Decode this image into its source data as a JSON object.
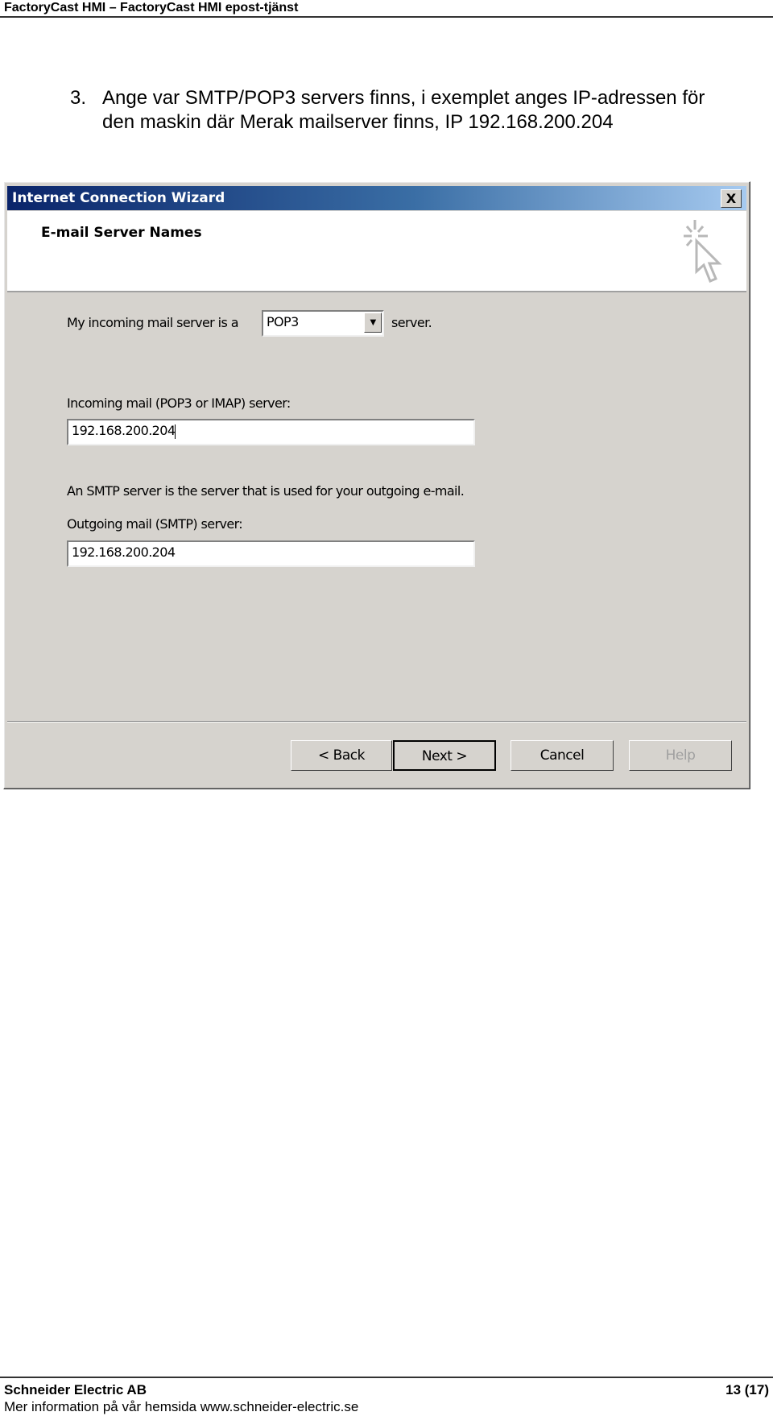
{
  "header": {
    "title": "FactoryCast HMI – FactoryCast HMI epost-tjänst"
  },
  "instruction": {
    "number": "3.",
    "line1": "Ange var SMTP/POP3 servers finns, i exemplet anges IP-adressen för",
    "line2": "den maskin där Merak mailserver finns, IP 192.168.200.204"
  },
  "dialog": {
    "title": "Internet Connection Wizard",
    "close_label": "X",
    "page_title": "E-mail Server Names",
    "icon": "wizard-cursor-icon",
    "server_type_prefix": "My incoming mail server is a",
    "server_type_value": "POP3",
    "server_type_suffix": "server.",
    "incoming_label": "Incoming mail (POP3 or IMAP) server:",
    "incoming_value": "192.168.200.204",
    "smtp_description": "An SMTP server is the server that is used for your outgoing e-mail.",
    "outgoing_label": "Outgoing mail (SMTP) server:",
    "outgoing_value": "192.168.200.204",
    "buttons": {
      "back": "< Back",
      "next": "Next >",
      "cancel": "Cancel",
      "help": "Help"
    }
  },
  "footer": {
    "company": "Schneider Electric AB",
    "page": "13 (17)",
    "info": "Mer information på vår hemsida www.schneider-electric.se"
  }
}
